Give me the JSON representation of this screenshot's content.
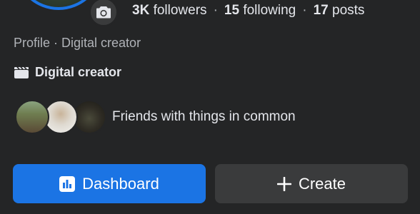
{
  "stats": {
    "followers_count": "3K",
    "followers_label": "followers",
    "following_count": "15",
    "following_label": "following",
    "posts_count": "17",
    "posts_label": "posts",
    "separator": "·"
  },
  "profile": {
    "subtitle": "Profile · Digital creator",
    "category": "Digital creator",
    "category_icon": "clapperboard-icon"
  },
  "friends": {
    "text": "Friends with things in common",
    "count": 3
  },
  "actions": {
    "dashboard_label": "Dashboard",
    "dashboard_icon": "bar-chart-icon",
    "create_label": "Create",
    "create_icon": "plus-icon"
  },
  "colors": {
    "background": "#242526",
    "primary": "#1b74e4",
    "secondary_button": "#3a3b3c",
    "text": "#e4e6eb",
    "muted_text": "#b0b3b8"
  }
}
